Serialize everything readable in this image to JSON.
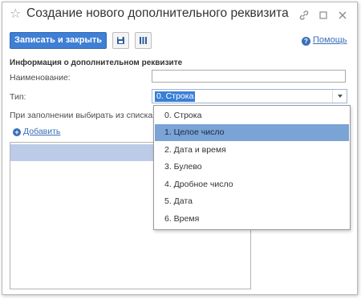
{
  "window": {
    "title": "Создание нового дополнительного реквизита"
  },
  "toolbar": {
    "save_close_label": "Записать и закрыть",
    "help_label": "Помощь"
  },
  "form": {
    "section_title": "Информация о дополнительном реквизите",
    "name_label": "Наименование:",
    "name_value": "",
    "type_label": "Тип:",
    "type_value": "0. Строка",
    "choose_from_list_label": "При заполнении выбирать из списка:",
    "add_label": "Добавить"
  },
  "type_dropdown": {
    "options": [
      "0. Строка",
      "1. Целое число",
      "2. Дата и время",
      "3. Булево",
      "4. Дробное число",
      "5. Дата",
      "6. Время"
    ],
    "selected_index": 1
  },
  "colors": {
    "primary_button": "#3f7fd4",
    "link": "#3a6fb8",
    "dropdown_highlight": "#7aa3d6",
    "list_selection": "#bccbe7"
  }
}
